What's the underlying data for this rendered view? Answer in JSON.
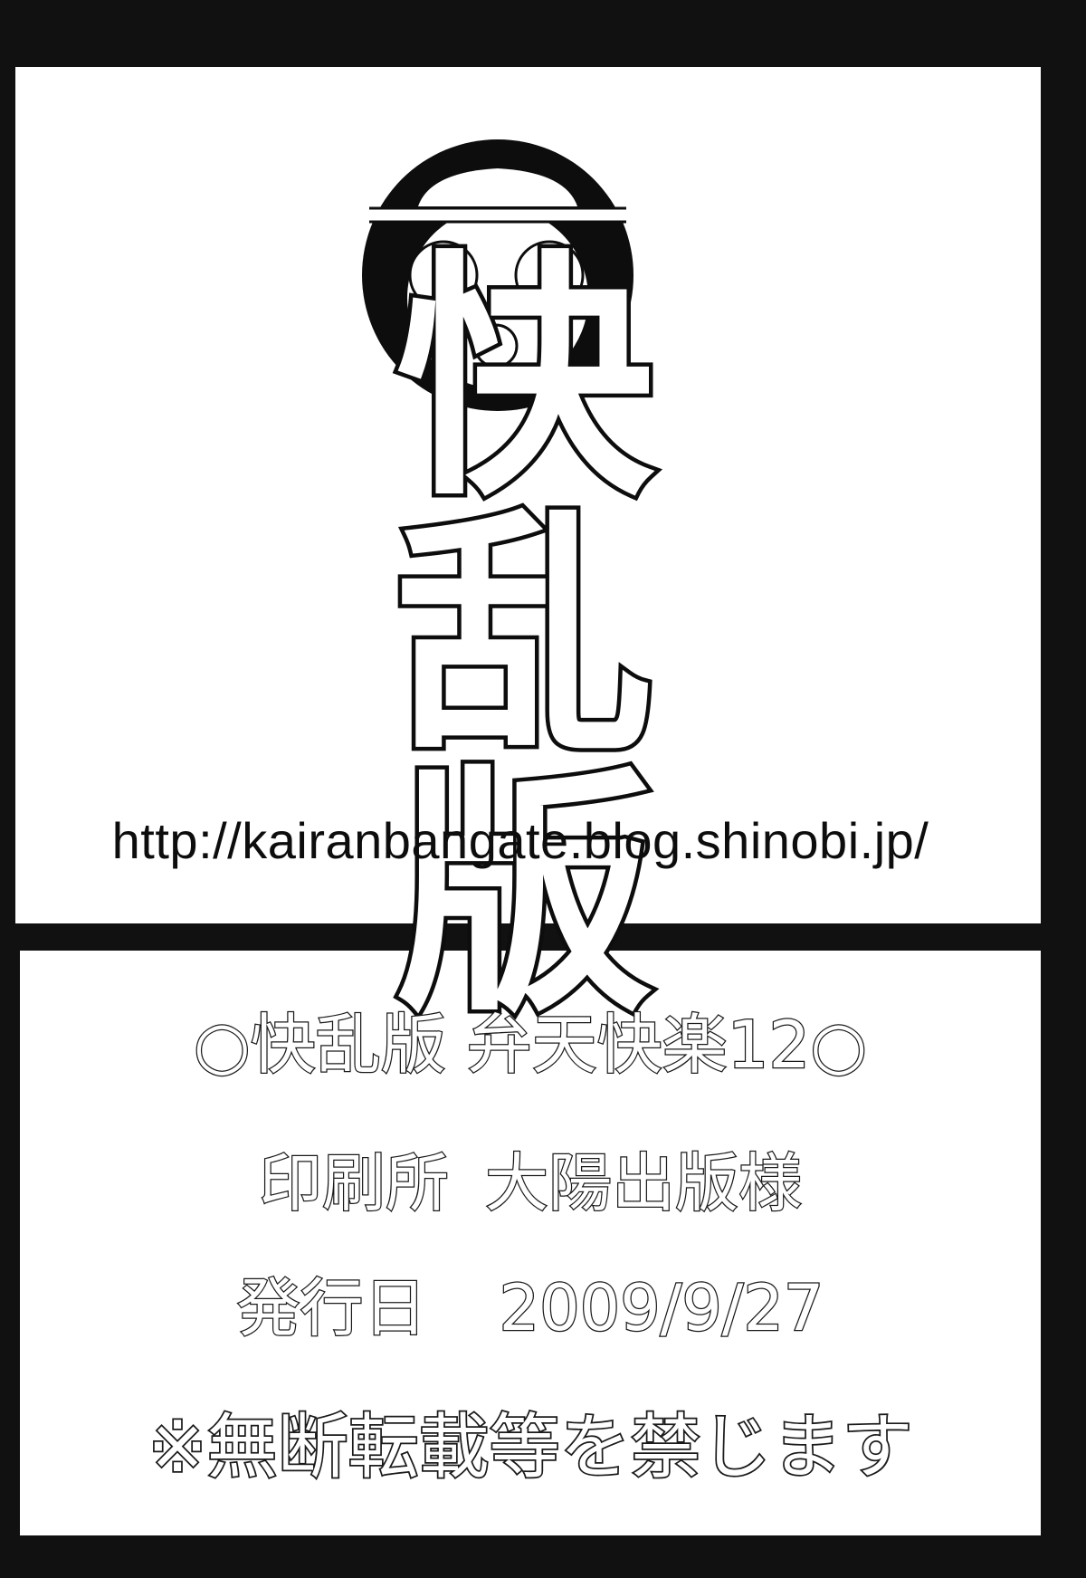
{
  "circle_title": "快乱版",
  "url": "http://kairanbangate.blog.shinobi.jp/",
  "colophon": {
    "title_left_mark": "○",
    "title": "快乱版 弁天快楽12",
    "title_right_mark": "○",
    "printer_label": "印刷所",
    "printer_value": "大陽出版様",
    "date_label": "発行日",
    "date_value": "2009/9/27",
    "notice": "※無断転載等を禁じます"
  },
  "logo": {
    "icon": "skull-face-with-cap-logo",
    "colors": {
      "ink": "#0d0d0d",
      "paper": "#ffffff"
    }
  }
}
